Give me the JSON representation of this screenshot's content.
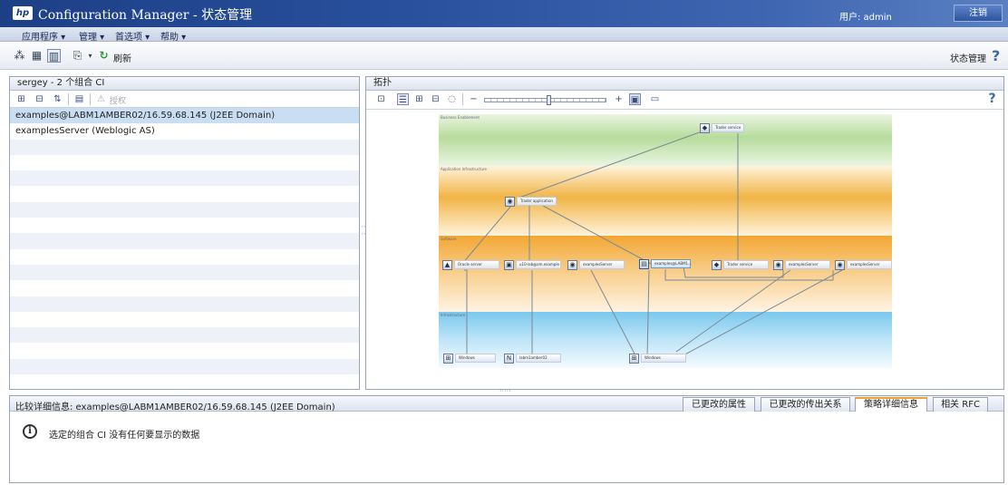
{
  "app": {
    "logo": "hp",
    "title": "Configuration Manager - 状态管理",
    "user_label": "用户: admin",
    "logout": "注销"
  },
  "menu": {
    "items": [
      "应用程序 ▾",
      "管理 ▾",
      "首选项 ▾",
      "帮助 ▾"
    ]
  },
  "toolbar": {
    "refresh_label": "刷新",
    "mode_label": "状态管理",
    "help": "?"
  },
  "left_panel": {
    "title": "sergey - 2 个组合 CI",
    "authorize_label": "授权",
    "rows": [
      "examples@LABM1AMBER02/16.59.68.145 (J2EE Domain)",
      "examplesServer (Weblogic AS)"
    ]
  },
  "topology_panel": {
    "title": "拓扑",
    "help": "?",
    "zoom_level_fraction": 0.52,
    "layers": [
      "Business Enablement",
      "Application Infrastructure",
      "Software",
      "Infrastructure"
    ],
    "nodes": {
      "trader_service_top": "Trader service",
      "trader_application": "Trader application",
      "n1": "Oracle server",
      "n2": "u10-lab@am.example",
      "n3": "examplesServer",
      "n4": "examples@LABM1...",
      "n5": "Trader service",
      "n6": "examplesServer",
      "n7": "examplesServer",
      "w1": "Windows",
      "w2": "labm1amber02",
      "w3": "Windows"
    }
  },
  "bottom_panel": {
    "title": "比较详细信息: examples@LABM1AMBER02/16.59.68.145 (J2EE Domain)",
    "tabs": [
      "已更改的属性",
      "已更改的传出关系",
      "策略详细信息",
      "相关 RFC"
    ],
    "active_tab": 2,
    "message": "选定的组合 CI 没有任何要显示的数据"
  },
  "colors": {
    "titlebar": "#28509c",
    "selected_row": "#c9def3",
    "active_tab_accent": "#f0a030",
    "band_business": "#b7dc9c",
    "band_appinfra": "#f1b445",
    "band_software": "#f3a733",
    "band_infra": "#7ac8ee"
  }
}
